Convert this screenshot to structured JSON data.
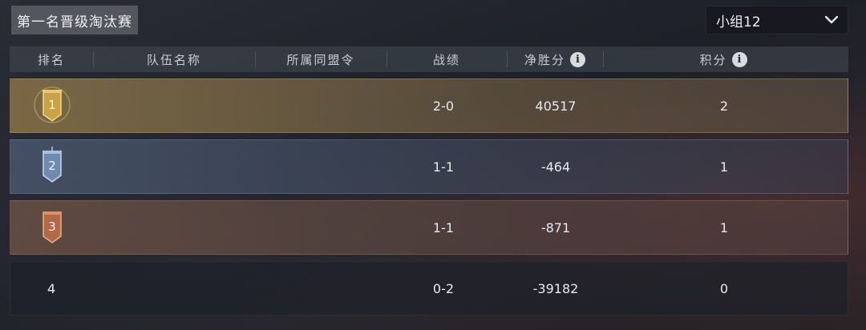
{
  "title": "第一名晋级淘汰赛",
  "group_select": {
    "selected": "小组12"
  },
  "columns": {
    "rank": "排名",
    "team_name": "队伍名称",
    "alliance": "所属同盟令",
    "record": "战绩",
    "net_score": "净胜分",
    "points": "积分"
  },
  "icons": {
    "info": "info-icon",
    "dropdown": "chevron-down-icon",
    "medal": "rank-medal-icon"
  },
  "colors": {
    "gold_row": "#96804b",
    "silver_row": "#505f78",
    "bronze_row": "#785848",
    "plain_row": "#1e212a"
  },
  "rows": [
    {
      "rank": "1",
      "team_name": "",
      "alliance": "",
      "record": "2-0",
      "net_score": "40517",
      "points": "2"
    },
    {
      "rank": "2",
      "team_name": "",
      "alliance": "",
      "record": "1-1",
      "net_score": "-464",
      "points": "1"
    },
    {
      "rank": "3",
      "team_name": "",
      "alliance": "",
      "record": "1-1",
      "net_score": "-871",
      "points": "1"
    },
    {
      "rank": "4",
      "team_name": "",
      "alliance": "",
      "record": "0-2",
      "net_score": "-39182",
      "points": "0"
    }
  ]
}
